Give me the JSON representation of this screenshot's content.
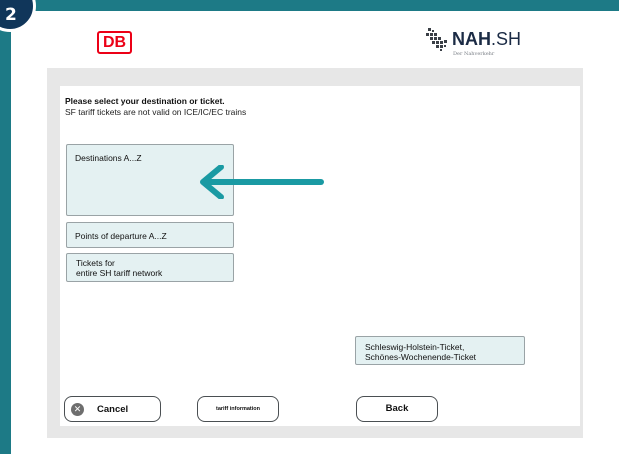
{
  "step_badge": "2",
  "header": {
    "db_logo": "DB",
    "nah_logo": {
      "bold": "NAH",
      "rest": ".SH",
      "tagline": "Der Nahverkehr"
    }
  },
  "prompt": {
    "title": "Please select your destination or ticket.",
    "subtitle": "SF tariff tickets are not valid on ICE/IC/EC trains"
  },
  "options": {
    "destinations": "Destinations A...Z",
    "departure_points": "Points of departure  A...Z",
    "network_tickets": [
      "Tickets for",
      "entire SH tariff network"
    ],
    "sh_tickets": [
      "Schleswig-Holstein-Ticket,",
      "Schönes-Wochenende-Ticket"
    ]
  },
  "buttons": {
    "cancel": "Cancel",
    "tariff_info": "tariff information",
    "back": "Back"
  },
  "icons": {
    "cancel": "close-circle-icon",
    "pointer": "arrow-left-icon"
  },
  "colors": {
    "frame": "#1d7a86",
    "option_bg": "#e4f1f2",
    "arrow": "#1a9aa3",
    "db_red": "#ec0016",
    "badge": "#10365a"
  }
}
